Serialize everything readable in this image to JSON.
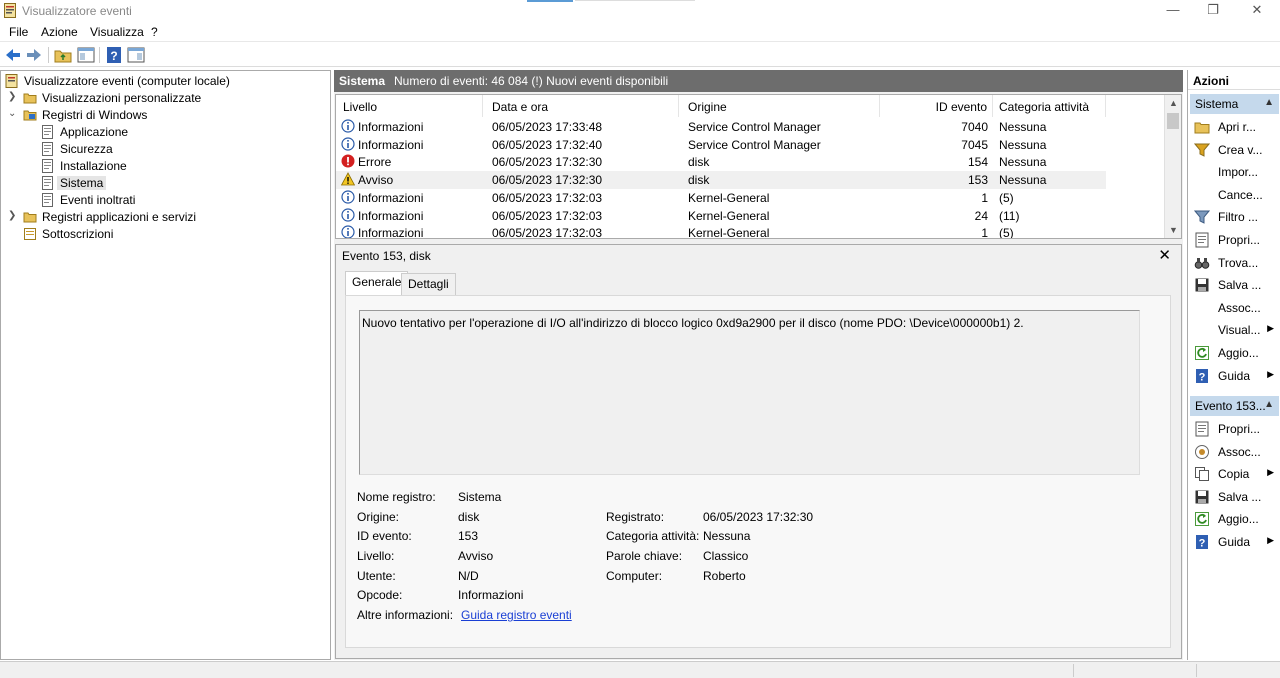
{
  "window": {
    "title": "Visualizzatore eventi"
  },
  "menu": [
    "File",
    "Azione",
    "Visualizza",
    "?"
  ],
  "tree": {
    "root": "Visualizzatore eventi (computer locale)",
    "custom_views": "Visualizzazioni personalizzate",
    "windows_logs": "Registri di Windows",
    "logs": [
      "Applicazione",
      "Sicurezza",
      "Installazione",
      "Sistema",
      "Eventi inoltrati"
    ],
    "app_services": "Registri applicazioni e servizi",
    "subscriptions": "Sottoscrizioni"
  },
  "header": {
    "name": "Sistema",
    "count": "Numero di eventi: 46 084 (!) Nuovi eventi disponibili"
  },
  "columns": [
    "Livello",
    "Data e ora",
    "Origine",
    "ID evento",
    "Categoria attività"
  ],
  "events": [
    {
      "level": "Informazioni",
      "icon": "info-icon",
      "date": "06/05/2023 17:33:48",
      "source": "Service Control Manager",
      "id": "7040",
      "category": "Nessuna"
    },
    {
      "level": "Informazioni",
      "icon": "info-icon",
      "date": "06/05/2023 17:32:40",
      "source": "Service Control Manager",
      "id": "7045",
      "category": "Nessuna"
    },
    {
      "level": "Errore",
      "icon": "error-icon",
      "date": "06/05/2023 17:32:30",
      "source": "disk",
      "id": "154",
      "category": "Nessuna"
    },
    {
      "level": "Avviso",
      "icon": "warning-icon",
      "date": "06/05/2023 17:32:30",
      "source": "disk",
      "id": "153",
      "category": "Nessuna"
    },
    {
      "level": "Informazioni",
      "icon": "info-icon",
      "date": "06/05/2023 17:32:03",
      "source": "Kernel-General",
      "id": "1",
      "category": "(5)"
    },
    {
      "level": "Informazioni",
      "icon": "info-icon",
      "date": "06/05/2023 17:32:03",
      "source": "Kernel-General",
      "id": "24",
      "category": "(11)"
    },
    {
      "level": "Informazioni",
      "icon": "info-icon",
      "date": "06/05/2023 17:32:03",
      "source": "Kernel-General",
      "id": "1",
      "category": "(5)"
    }
  ],
  "detail": {
    "title": "Evento 153, disk",
    "tabs": [
      "Generale",
      "Dettagli"
    ],
    "description": "Nuovo tentativo per l'operazione di I/O all'indirizzo di blocco logico 0xd9a2900 per il disco (nome PDO: \\Device\\000000b1) 2.",
    "fields": {
      "log_name_label": "Nome registro:",
      "log_name": "Sistema",
      "source_label": "Origine:",
      "source": "disk",
      "logged_label": "Registrato:",
      "logged": "06/05/2023 17:32:30",
      "event_id_label": "ID evento:",
      "event_id": "153",
      "task_label": "Categoria attività:",
      "task": "Nessuna",
      "level_label": "Livello:",
      "level": "Avviso",
      "keywords_label": "Parole chiave:",
      "keywords": "Classico",
      "user_label": "Utente:",
      "user": "N/D",
      "computer_label": "Computer:",
      "computer": "Roberto",
      "opcode_label": "Opcode:",
      "opcode": "Informazioni",
      "more_label": "Altre informazioni:",
      "more_link": "Guida registro eventi"
    }
  },
  "actions": {
    "title": "Azioni",
    "section1": "Sistema",
    "items1": [
      {
        "label": "Apri r...",
        "icon": "folder-open-icon",
        "sub": false
      },
      {
        "label": "Crea v...",
        "icon": "filter-create-icon",
        "sub": false
      },
      {
        "label": "Impor...",
        "icon": "",
        "sub": false
      },
      {
        "label": "Cance...",
        "icon": "",
        "sub": false
      },
      {
        "label": "Filtro ...",
        "icon": "filter-icon",
        "sub": false
      },
      {
        "label": "Propri...",
        "icon": "properties-icon",
        "sub": false
      },
      {
        "label": "Trova...",
        "icon": "binoculars-icon",
        "sub": false
      },
      {
        "label": "Salva ...",
        "icon": "save-icon",
        "sub": false
      },
      {
        "label": "Assoc...",
        "icon": "",
        "sub": false
      },
      {
        "label": "Visual...",
        "icon": "",
        "sub": true
      },
      {
        "label": "Aggio...",
        "icon": "refresh-icon",
        "sub": false
      },
      {
        "label": "Guida",
        "icon": "help-icon",
        "sub": true
      }
    ],
    "section2": "Evento 153...",
    "items2": [
      {
        "label": "Propri...",
        "icon": "properties-icon",
        "sub": false
      },
      {
        "label": "Assoc...",
        "icon": "task-icon",
        "sub": false
      },
      {
        "label": "Copia",
        "icon": "copy-icon",
        "sub": true
      },
      {
        "label": "Salva ...",
        "icon": "save-icon",
        "sub": false
      },
      {
        "label": "Aggio...",
        "icon": "refresh-icon",
        "sub": false
      },
      {
        "label": "Guida",
        "icon": "help-icon",
        "sub": true
      }
    ]
  },
  "colors": {
    "header_bg": "#6d6d6d",
    "section_bg": "#c5d9ec",
    "link": "#1a3fd4"
  }
}
